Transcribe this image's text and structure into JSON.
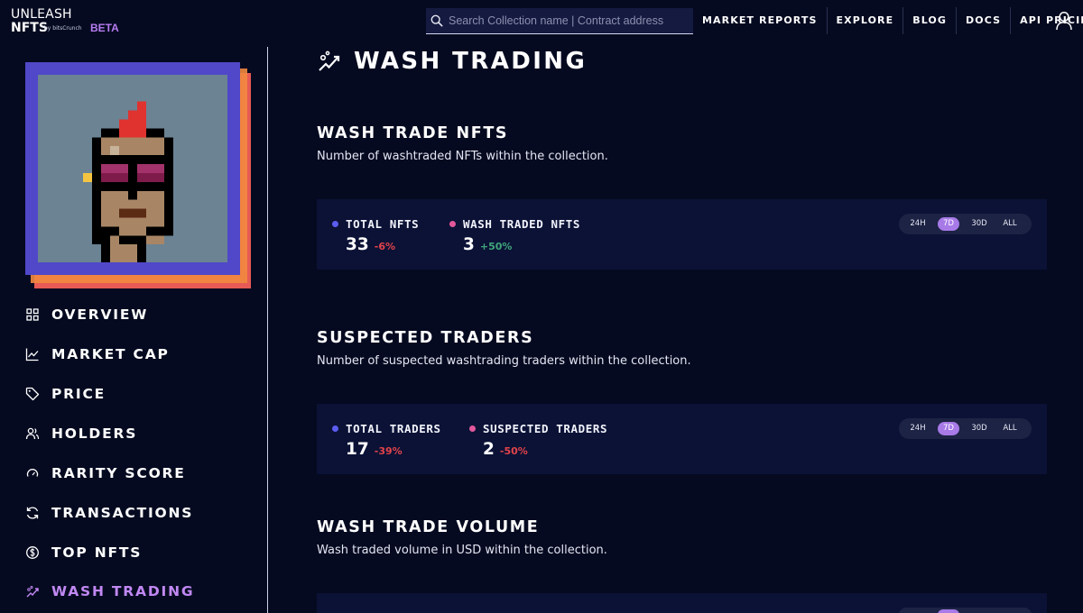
{
  "header": {
    "logo_line1": "UNLEASH",
    "logo_line2": "NFTS",
    "logo_by": "by bitsCrunch",
    "logo_beta": "BETA",
    "search_placeholder": "Search Collection name | Contract address",
    "nav": [
      "MARKET REPORTS",
      "EXPLORE",
      "BLOG",
      "DOCS",
      "API PRICING"
    ]
  },
  "sidebar": {
    "items": [
      {
        "label": "OVERVIEW",
        "icon": "grid-icon"
      },
      {
        "label": "MARKET CAP",
        "icon": "line-chart-icon"
      },
      {
        "label": "PRICE",
        "icon": "tag-icon"
      },
      {
        "label": "HOLDERS",
        "icon": "users-icon"
      },
      {
        "label": "RARITY SCORE",
        "icon": "gauge-icon"
      },
      {
        "label": "TRANSACTIONS",
        "icon": "refresh-icon"
      },
      {
        "label": "TOP NFTS",
        "icon": "coin-icon"
      },
      {
        "label": "WASH TRADING",
        "icon": "wash-trading-icon"
      }
    ],
    "active": "WASH TRADING"
  },
  "main": {
    "page_title": "WASH TRADING",
    "sections": [
      {
        "title": "WASH TRADE NFTS",
        "description": "Number of washtraded NFTs within the collection.",
        "metrics": [
          {
            "label": "TOTAL NFTS",
            "value": "33",
            "change": "-6%",
            "dot_color": "#5b5cf0",
            "trend": "neg"
          },
          {
            "label": "WASH TRADED NFTS",
            "value": "3",
            "change": "+50%",
            "dot_color": "#e2589b",
            "trend": "pos"
          }
        ],
        "ranges": [
          "24H",
          "7D",
          "30D",
          "ALL"
        ],
        "selected_range": "7D"
      },
      {
        "title": "SUSPECTED TRADERS",
        "description": "Number of suspected washtrading traders within the collection.",
        "metrics": [
          {
            "label": "TOTAL TRADERS",
            "value": "17",
            "change": "-39%",
            "dot_color": "#5b5cf0",
            "trend": "neg"
          },
          {
            "label": "SUSPECTED TRADERS",
            "value": "2",
            "change": "-50%",
            "dot_color": "#e2589b",
            "trend": "neg"
          }
        ],
        "ranges": [
          "24H",
          "7D",
          "30D",
          "ALL"
        ],
        "selected_range": "7D"
      },
      {
        "title": "WASH TRADE VOLUME",
        "description": "Wash traded volume in USD within the collection."
      }
    ]
  },
  "colors": {
    "background": "#050a20",
    "card": "#0b1236",
    "accent_purple": "#c188f3",
    "negative": "#e2434b",
    "positive": "#3fa57a"
  }
}
